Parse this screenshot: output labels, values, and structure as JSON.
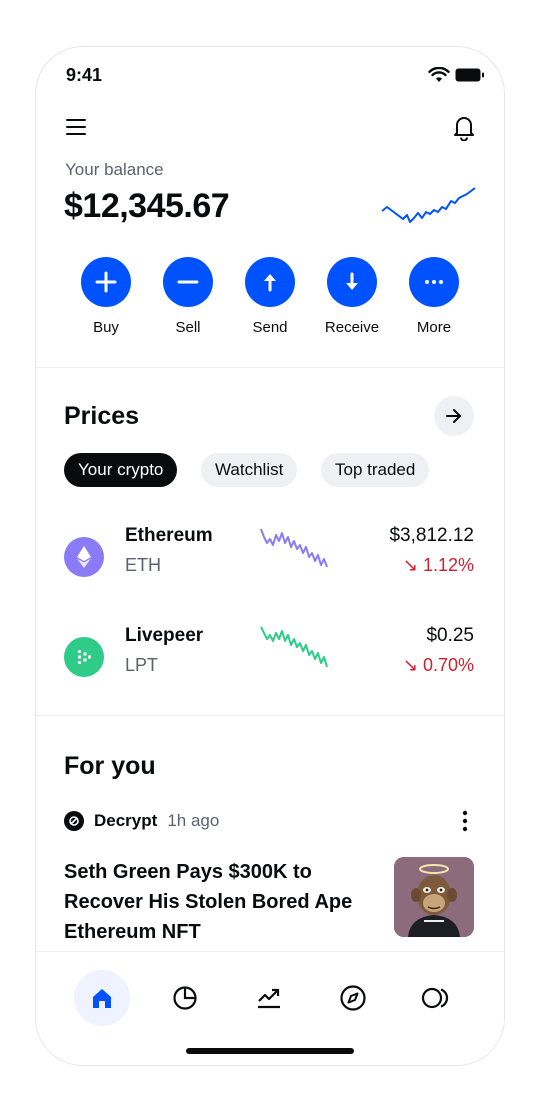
{
  "status_bar": {
    "time": "9:41"
  },
  "balance": {
    "label": "Your balance",
    "value": "$12,345.67"
  },
  "actions": [
    {
      "label": "Buy",
      "icon": "plus-icon"
    },
    {
      "label": "Sell",
      "icon": "minus-icon"
    },
    {
      "label": "Send",
      "icon": "arrow-up-icon"
    },
    {
      "label": "Receive",
      "icon": "arrow-down-icon"
    },
    {
      "label": "More",
      "icon": "ellipsis-icon"
    }
  ],
  "prices": {
    "title": "Prices",
    "chips": [
      "Your crypto",
      "Watchlist",
      "Top traded"
    ],
    "assets": [
      {
        "name": "Ethereum",
        "symbol": "ETH",
        "price": "$3,812.12",
        "change": "↘ 1.12%",
        "color": "#8a7cf6"
      },
      {
        "name": "Livepeer",
        "symbol": "LPT",
        "price": "$0.25",
        "change": "↘ 0.70%",
        "color": "#2ecc87"
      }
    ]
  },
  "for_you": {
    "title": "For you",
    "source": "Decrypt",
    "time": "1h ago",
    "headline": "Seth Green Pays $300K to Recover His Stolen Bored Ape Ethereum NFT"
  },
  "tabbar": [
    "home-icon",
    "portfolio-icon",
    "trade-icon",
    "explore-icon",
    "web3-icon"
  ],
  "colors": {
    "accent": "#0052ff",
    "negative": "#cf202f"
  }
}
